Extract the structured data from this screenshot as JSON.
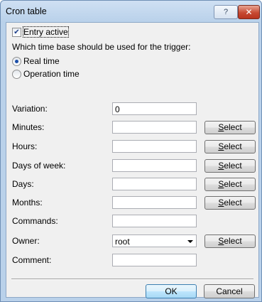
{
  "window": {
    "title": "Cron table",
    "help_label": "?",
    "close_label": "✕"
  },
  "entry_active": {
    "label": "Entry active",
    "checked": true
  },
  "time_base": {
    "question": "Which time base should be used for the trigger:",
    "options": [
      {
        "label": "Real time",
        "selected": true
      },
      {
        "label": "Operation time",
        "selected": false
      }
    ]
  },
  "fields": [
    {
      "label": "Variation:",
      "value": "0",
      "has_select": false
    },
    {
      "label": "Minutes:",
      "value": "",
      "has_select": true
    },
    {
      "label": "Hours:",
      "value": "",
      "has_select": true
    },
    {
      "label": "Days of week:",
      "value": "",
      "has_select": true
    },
    {
      "label": "Days:",
      "value": "",
      "has_select": true
    },
    {
      "label": "Months:",
      "value": "",
      "has_select": true
    },
    {
      "label": "Commands:",
      "value": "",
      "has_select": false
    }
  ],
  "owner": {
    "label": "Owner:",
    "value": "root"
  },
  "comment": {
    "label": "Comment:",
    "value": ""
  },
  "select_label": "Select",
  "buttons": {
    "ok": "OK",
    "cancel": "Cancel"
  }
}
